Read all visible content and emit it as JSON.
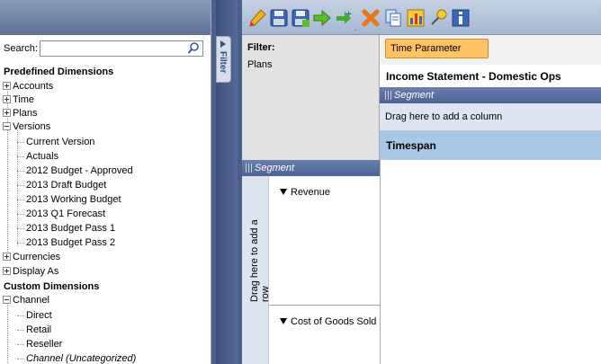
{
  "search": {
    "label": "Search:",
    "value": "",
    "placeholder": ""
  },
  "tree": {
    "predefined_header": "Predefined Dimensions",
    "predefined": [
      {
        "label": "Accounts",
        "expand": "plus"
      },
      {
        "label": "Time",
        "expand": "plus"
      },
      {
        "label": "Plans",
        "expand": "plus"
      },
      {
        "label": "Versions",
        "expand": "minus"
      }
    ],
    "versions_children": [
      "Current Version",
      "Actuals",
      "2012 Budget - Approved",
      "2013 Draft Budget",
      "2013 Working Budget",
      "2013 Q1 Forecast",
      "2013 Budget Pass 1",
      "2013 Budget Pass 2"
    ],
    "predefined_more": [
      {
        "label": "Currencies",
        "expand": "plus"
      },
      {
        "label": "Display As",
        "expand": "plus"
      }
    ],
    "custom_header": "Custom Dimensions",
    "custom": [
      {
        "label": "Channel",
        "expand": "minus"
      }
    ],
    "channel_children": [
      "Direct",
      "Retail",
      "Reseller",
      "Channel (Uncategorized)"
    ]
  },
  "filter_tab": {
    "label": "Filter"
  },
  "toolbar": {
    "buttons": [
      "pencil-icon",
      "save-icon",
      "save-as-icon",
      "run-arrow-icon",
      "add-icon",
      "delete-icon",
      "copy-icon",
      "chart-icon",
      "pin-icon",
      "info-icon"
    ]
  },
  "filter_panel": {
    "title": "Filter:",
    "items": [
      "Plans"
    ]
  },
  "time_parameter": "Time Parameter",
  "report_title": "Income Statement - Domestic Ops",
  "column_segment": {
    "header": "Segment",
    "drop_hint": "Drag here to add a column",
    "timespan": "Timespan"
  },
  "row_segment": {
    "header": "Segment",
    "drop_hint": "Drag here to add a row",
    "rows": [
      "Revenue",
      "Cost of Goods Sold"
    ]
  },
  "colors": {
    "accent_orange": "#ffc266",
    "header_blue": "#5d6f96",
    "timespan_blue": "#a8c8e6",
    "drop_zone": "#dde6f0"
  }
}
